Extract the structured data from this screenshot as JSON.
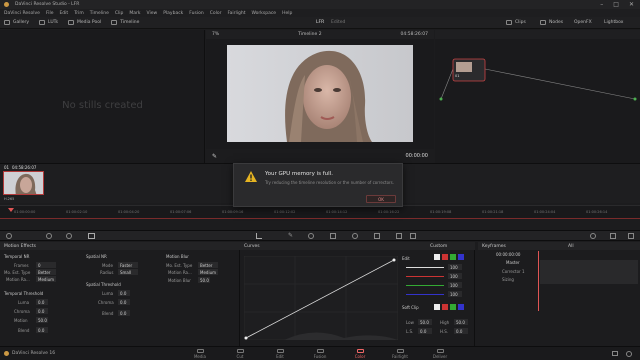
{
  "app": {
    "title": "DaVinci Resolve Studio - LFR",
    "window_controls": [
      "–",
      "□",
      "✕"
    ]
  },
  "menu": [
    "DaVinci Resolve",
    "File",
    "Edit",
    "Trim",
    "Timeline",
    "Clip",
    "Mark",
    "View",
    "Playback",
    "Fusion",
    "Color",
    "Fairlight",
    "Workspace",
    "Help"
  ],
  "toolbar": {
    "left": [
      "Gallery",
      "LUTs",
      "Media Pool",
      "Timeline"
    ],
    "project": "LFR",
    "project_state": "Edited",
    "right": [
      "Clips",
      "Nodes",
      "OpenFX",
      "Lightbox"
    ]
  },
  "gallery": {
    "empty_text": "No stills created"
  },
  "viewer": {
    "zoom": "7%",
    "timeline": "Timeline 2",
    "timecode": "04:58:26:07",
    "playhead_tc": "00:00:00"
  },
  "nodes": {
    "node1_label": "01"
  },
  "clips": {
    "clip1_index": "01",
    "clip1_tc": "04:58:26:07",
    "clip1_codec": "H.265"
  },
  "timeline_ticks": [
    "01:00:00:00",
    "01:00:02:10",
    "01:00:04:20",
    "01:00:07:06",
    "01:00:09:16",
    "01:00:12:02",
    "01:00:14:12",
    "01:00:16:22",
    "01:00:19:08",
    "01:00:21:18",
    "01:00:24:04",
    "01:00:26:14"
  ],
  "modal": {
    "message": "Your GPU memory is full.",
    "sub": "Try reducing the timeline resolution or the number of correctors.",
    "ok_label": "OK"
  },
  "motion": {
    "title": "Motion Effects",
    "temporal_nr": {
      "title": "Temporal NR",
      "rows": [
        {
          "label": "Frames",
          "value": "0"
        },
        {
          "label": "Mo. Est. Type",
          "value": "Better"
        },
        {
          "label": "Motion Ra...",
          "value": "Medium"
        }
      ]
    },
    "temporal_threshold": {
      "title": "Temporal Threshold",
      "rows": [
        {
          "label": "Luma",
          "value": "0.0"
        },
        {
          "label": "Chroma",
          "value": "0.0"
        },
        {
          "label": "Motion",
          "value": "50.0"
        },
        {
          "label": "Blend",
          "value": "0.0"
        }
      ]
    },
    "spatial_nr": {
      "title": "Spatial NR",
      "rows": [
        {
          "label": "Mode",
          "value": "Faster"
        },
        {
          "label": "Radius",
          "value": "Small"
        }
      ]
    },
    "spatial_threshold": {
      "title": "Spatial Threshold",
      "rows": [
        {
          "label": "Luma",
          "value": "0.0"
        },
        {
          "label": "Chroma",
          "value": "0.0"
        },
        {
          "label": "Blend",
          "value": "0.0"
        }
      ]
    },
    "motion_blur": {
      "title": "Motion Blur",
      "rows": [
        {
          "label": "Mo. Est. Type",
          "value": "Better"
        },
        {
          "label": "Motion Ra...",
          "value": "Medium"
        },
        {
          "label": "Motion Blur",
          "value": "50.0"
        }
      ]
    }
  },
  "curves": {
    "title": "Curves",
    "mode": "Custom",
    "edit_label": "Edit",
    "channel_values": [
      "100",
      "100",
      "100",
      "100"
    ],
    "soft_clip": "Soft Clip",
    "low_label": "Low",
    "low_value": "50.0",
    "high_label": "High",
    "high_value": "50.0",
    "ls_label": "L.S.",
    "ls_value": "0.0",
    "hs_label": "H.S.",
    "hs_value": "0.0"
  },
  "keyframes": {
    "title": "Keyframes",
    "filter": "All",
    "timecode": "00:00:00:00",
    "tracks": [
      "Master",
      "Corrector 1",
      "Sizing"
    ]
  },
  "pages": [
    "Media",
    "Cut",
    "Edit",
    "Fusion",
    "Color",
    "Fairlight",
    "Deliver"
  ],
  "active_page": "Color",
  "brand": {
    "name": "DaVinci Resolve 16",
    "accent": "#e05555"
  }
}
